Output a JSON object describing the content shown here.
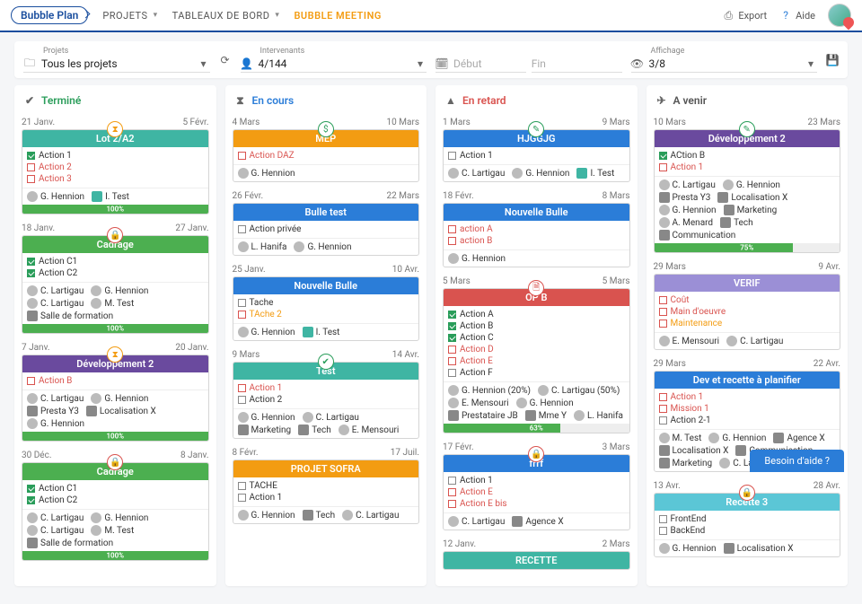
{
  "nav": {
    "logo": "Bubble Plan",
    "items": [
      "PROJETS",
      "TABLEAUX DE BORD",
      "BUBBLE MEETING"
    ],
    "export": "Export",
    "help": "Aide"
  },
  "filters": {
    "projects": {
      "label": "Projets",
      "value": "Tous les projets"
    },
    "people": {
      "label": "Intervenants",
      "value": "4/144"
    },
    "start": {
      "placeholder": "Début"
    },
    "end": {
      "placeholder": "Fin"
    },
    "display": {
      "label": "Affichage",
      "value": "3/8"
    }
  },
  "columns": {
    "done": {
      "title": "Terminé"
    },
    "inprogress": {
      "title": "En cours"
    },
    "late": {
      "title": "En retard"
    },
    "upcoming": {
      "title": "A venir"
    }
  },
  "cards": {
    "lot2a2": {
      "dates": [
        "21 Janv.",
        "5 Févr."
      ],
      "title": "Lot 2/A2",
      "actions": [
        [
          "done",
          "Action 1"
        ],
        [
          "red",
          "Action 2"
        ],
        [
          "red",
          "Action 3"
        ]
      ],
      "people": [
        [
          "G. Hennion",
          "pava"
        ],
        [
          "I. Test",
          "pava teal2"
        ]
      ],
      "progress": "100%"
    },
    "cadrage1": {
      "dates": [
        "18 Janv.",
        "27 Janv."
      ],
      "title": "Cadrage",
      "actions": [
        [
          "done",
          "Action C1"
        ],
        [
          "done",
          "Action C2"
        ]
      ],
      "people": [
        [
          "C. Lartigau",
          "pava"
        ],
        [
          "G. Hennion",
          "pava"
        ],
        [
          "C. Lartigau",
          "pava"
        ],
        [
          "M. Test",
          "pava"
        ],
        [
          "Salle de formation",
          "pava sq"
        ]
      ],
      "progress": "100%"
    },
    "dev2a": {
      "dates": [
        "7 Janv.",
        "20 Janv."
      ],
      "title": "Développement 2",
      "actions": [
        [
          "red",
          "Action B"
        ]
      ],
      "people": [
        [
          "C. Lartigau",
          "pava"
        ],
        [
          "G. Hennion",
          "pava"
        ],
        [
          "Presta Y3",
          "pava sq"
        ],
        [
          "Localisation X",
          "pava sq"
        ],
        [
          "G. Hennion",
          "pava"
        ]
      ],
      "progress": "100%"
    },
    "cadrage2": {
      "dates": [
        "30 Déc.",
        "8 Janv."
      ],
      "title": "Cadrage",
      "actions": [
        [
          "done",
          "Action C1"
        ],
        [
          "done",
          "Action C2"
        ]
      ],
      "people": [
        [
          "C. Lartigau",
          "pava"
        ],
        [
          "G. Hennion",
          "pava"
        ],
        [
          "C. Lartigau",
          "pava"
        ],
        [
          "M. Test",
          "pava"
        ],
        [
          "Salle de formation",
          "pava sq"
        ]
      ],
      "progress": "100%"
    },
    "mep": {
      "dates": [
        "4 Mars",
        "10 Mars"
      ],
      "title": "MEP",
      "actions": [
        [
          "red",
          "Action DAZ"
        ]
      ],
      "people": [
        [
          "G. Hennion",
          "pava"
        ]
      ]
    },
    "bulletest": {
      "dates": [
        "26 Févr.",
        "22 Mars"
      ],
      "title": "Bulle test",
      "actions": [
        [
          "open",
          "Action privée"
        ]
      ],
      "people": [
        [
          "L. Hanifa",
          "pava"
        ],
        [
          "G. Hennion",
          "pava"
        ]
      ]
    },
    "nouvbulle1": {
      "dates": [
        "25 Janv.",
        "10 Avr."
      ],
      "title": "Nouvelle Bulle",
      "actions": [
        [
          "open",
          "Tache"
        ],
        [
          "orange",
          "TAche 2"
        ]
      ],
      "people": [
        [
          "G. Hennion",
          "pava"
        ],
        [
          "I. Test",
          "pava teal2"
        ]
      ]
    },
    "test": {
      "dates": [
        "9 Mars",
        "14 Avr."
      ],
      "title": "Test",
      "actions": [
        [
          "red",
          "Action 1"
        ],
        [
          "open",
          "Action 2"
        ]
      ],
      "people": [
        [
          "G. Hennion",
          "pava"
        ],
        [
          "C. Lartigau",
          "pava"
        ],
        [
          "Marketing",
          "pava sq"
        ],
        [
          "Tech",
          "pava sq"
        ],
        [
          "E. Mensouri",
          "pava"
        ]
      ]
    },
    "sofra": {
      "dates": [
        "8 Févr.",
        "17 Juil."
      ],
      "title": "PROJET SOFRA",
      "actions": [
        [
          "open",
          "TACHE"
        ],
        [
          "open",
          "Action 1"
        ]
      ],
      "people": [
        [
          "G. Hennion",
          "pava"
        ],
        [
          "Tech",
          "pava sq"
        ],
        [
          "C. Lartigau",
          "pava"
        ]
      ]
    },
    "hjggjg": {
      "dates": [
        "1 Mars",
        "9 Mars"
      ],
      "title": "HJGGJG",
      "actions": [
        [
          "open",
          "Action 1"
        ]
      ],
      "people": [
        [
          "C. Lartigau",
          "pava"
        ],
        [
          "G. Hennion",
          "pava"
        ],
        [
          "I. Test",
          "pava teal2"
        ]
      ]
    },
    "nouvbulle2": {
      "dates": [
        "18 Févr.",
        "8 Mars"
      ],
      "title": "Nouvelle Bulle",
      "actions": [
        [
          "red",
          "action A"
        ],
        [
          "red",
          "action B"
        ]
      ],
      "people": [
        [
          "G. Hennion",
          "pava"
        ]
      ]
    },
    "opb": {
      "dates": [
        "5 Mars",
        "5 Mars"
      ],
      "title": "OP B",
      "actions": [
        [
          "done",
          "Action A"
        ],
        [
          "done",
          "Action B"
        ],
        [
          "done",
          "Action C"
        ],
        [
          "red",
          "Action D"
        ],
        [
          "red",
          "Action E"
        ],
        [
          "open",
          "Action F"
        ]
      ],
      "people": [
        [
          "G. Hennion (20%)",
          "pava"
        ],
        [
          "C. Lartigau (50%)",
          "pava"
        ],
        [
          "E. Mensouri",
          "pava"
        ],
        [
          "G. Hennion",
          "pava"
        ],
        [
          "Prestataire JB",
          "pava sq"
        ],
        [
          "Mme Y",
          "pava sq"
        ],
        [
          "L. Hanifa",
          "pava"
        ]
      ],
      "progress": "63%"
    },
    "frrf": {
      "dates": [
        "17 Févr.",
        "3 Mars"
      ],
      "title": "frrf",
      "actions": [
        [
          "open",
          "Action 1"
        ],
        [
          "red",
          "Action E"
        ],
        [
          "red",
          "Action E bis"
        ]
      ],
      "people": [
        [
          "C. Lartigau",
          "pava"
        ],
        [
          "Agence X",
          "pava sq"
        ]
      ]
    },
    "recette": {
      "dates": [
        "12 Janv.",
        "2 Mars"
      ],
      "title": "RECETTE"
    },
    "dev2b": {
      "dates": [
        "10 Mars",
        "23 Mars"
      ],
      "title": "Développement 2",
      "actions": [
        [
          "done",
          "ACtion B"
        ],
        [
          "red",
          "Action 1"
        ]
      ],
      "people": [
        [
          "C. Lartigau",
          "pava"
        ],
        [
          "G. Hennion",
          "pava"
        ],
        [
          "Presta Y3",
          "pava sq"
        ],
        [
          "Localisation X",
          "pava sq"
        ],
        [
          "G. Hennion",
          "pava"
        ],
        [
          "Marketing",
          "pava sq"
        ],
        [
          "A. Menard",
          "pava"
        ],
        [
          "Tech",
          "pava sq"
        ],
        [
          "Communication",
          "pava sq"
        ]
      ],
      "progress": "75%"
    },
    "verif": {
      "dates": [
        "29 Mars",
        "9 Avr."
      ],
      "title": "VERIF",
      "actions": [
        [
          "red",
          "Coût"
        ],
        [
          "red",
          "Main d'oeuvre"
        ],
        [
          "orange",
          "Maintenance"
        ]
      ],
      "people": [
        [
          "E. Mensouri",
          "pava"
        ],
        [
          "C. Lartigau",
          "pava"
        ]
      ]
    },
    "devrecette": {
      "dates": [
        "29 Mars",
        "22 Avr."
      ],
      "title": "Dev et recette à planifier",
      "actions": [
        [
          "red",
          "Action 1"
        ],
        [
          "red",
          "Mission 1"
        ],
        [
          "open",
          "Action 2-1"
        ]
      ],
      "people": [
        [
          "M. Test",
          "pava"
        ],
        [
          "G. Hennion",
          "pava"
        ],
        [
          "Agence X",
          "pava sq"
        ],
        [
          "Localisation X",
          "pava sq"
        ],
        [
          "Communication",
          "pava sq"
        ],
        [
          "Marketing",
          "pava sq"
        ],
        [
          "C. Lartigau",
          "pava"
        ]
      ]
    },
    "recette3": {
      "dates": [
        "13 Avr.",
        "28 Avr."
      ],
      "title": "Recette 3",
      "actions": [
        [
          "open",
          "FrontEnd"
        ],
        [
          "open",
          "BackEnd"
        ]
      ],
      "people": [
        [
          "G. Hennion",
          "pava"
        ],
        [
          "Localisation X",
          "pava sq"
        ]
      ]
    }
  },
  "helpbubble": "Besoin d'aide ?"
}
